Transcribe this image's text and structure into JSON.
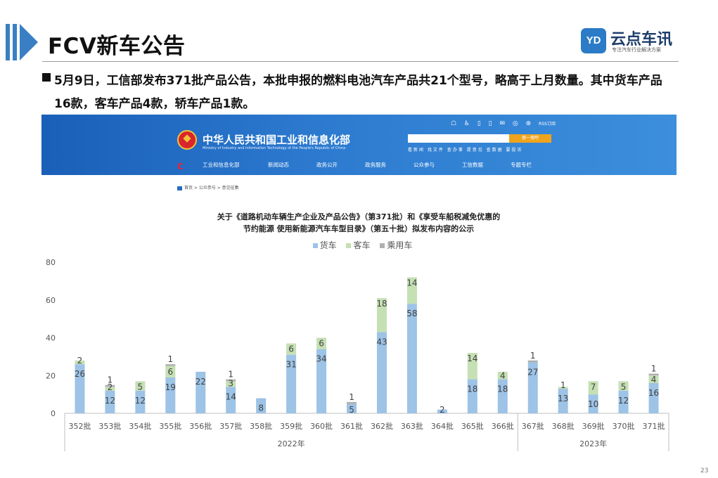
{
  "page": {
    "title": "FCV新车公告",
    "summary": "5月9日，工信部发布371批产品公告，本批申报的燃料电池汽车产品共21个型号，略高于上月数量。其中货车产品16款，客车产品4款，轿车产品1款。",
    "page_number": "23"
  },
  "logo": {
    "mark": "YD",
    "name": "云点车讯",
    "slogan": "专注汽车行业解决方案"
  },
  "miit": {
    "name_cn": "中华人民共和国工业和信息化部",
    "name_en": "Ministry of Industry and Information Technology of the People's Republic of China",
    "icons": "☖ ♿ ▯ ▯ ✉ ◎ ⊛",
    "rss": "RSS订阅",
    "search_button": "搜一搜吧",
    "quick_links": "看新闻 找文件 查办事 提意见 查数据 要投诉",
    "nav": [
      "工业和信息化部",
      "新闻动态",
      "政务公开",
      "政务服务",
      "公众参与",
      "工信数据",
      "专题专栏"
    ],
    "breadcrumb": "首页 > 公众参与 > 意见征集"
  },
  "colors": {
    "truck": "#9dc3e6",
    "bus": "#c5e0b4",
    "car": "#b0b0b0",
    "header_blue": "#2d7bd0",
    "title_blue": "#3a7fc4"
  },
  "chart_data": {
    "type": "bar",
    "stacked": true,
    "title_lines": [
      "关于《道路机动车辆生产企业及产品公告》（第371批）和《享受车船税减免优惠的",
      "节约能源 使用新能源汽车车型目录》（第五十批）拟发布内容的公示"
    ],
    "categories": [
      "352批",
      "353批",
      "354批",
      "355批",
      "356批",
      "357批",
      "358批",
      "359批",
      "360批",
      "361批",
      "362批",
      "363批",
      "364批",
      "365批",
      "366批",
      "367批",
      "368批",
      "369批",
      "370批",
      "371批"
    ],
    "groups": [
      {
        "label": "2022年",
        "from": 0,
        "to": 14
      },
      {
        "label": "2023年",
        "from": 15,
        "to": 19
      }
    ],
    "series": [
      {
        "name": "货车",
        "values": [
          26,
          12,
          12,
          19,
          22,
          14,
          8,
          31,
          34,
          5,
          43,
          58,
          2,
          18,
          18,
          27,
          13,
          10,
          12,
          16
        ]
      },
      {
        "name": "客车",
        "values": [
          2,
          2,
          5,
          6,
          0,
          3,
          0,
          6,
          6,
          0,
          18,
          14,
          0,
          14,
          4,
          0,
          1,
          7,
          5,
          4
        ]
      },
      {
        "name": "乘用车",
        "values": [
          0,
          1,
          0,
          1,
          0,
          1,
          0,
          0,
          0,
          1,
          0,
          0,
          0,
          0,
          0,
          1,
          0,
          0,
          0,
          1
        ]
      }
    ],
    "ylim": [
      0,
      80
    ],
    "yticks": [
      0,
      20,
      40,
      60,
      80
    ],
    "legend_position": "top-center",
    "grid": false
  }
}
